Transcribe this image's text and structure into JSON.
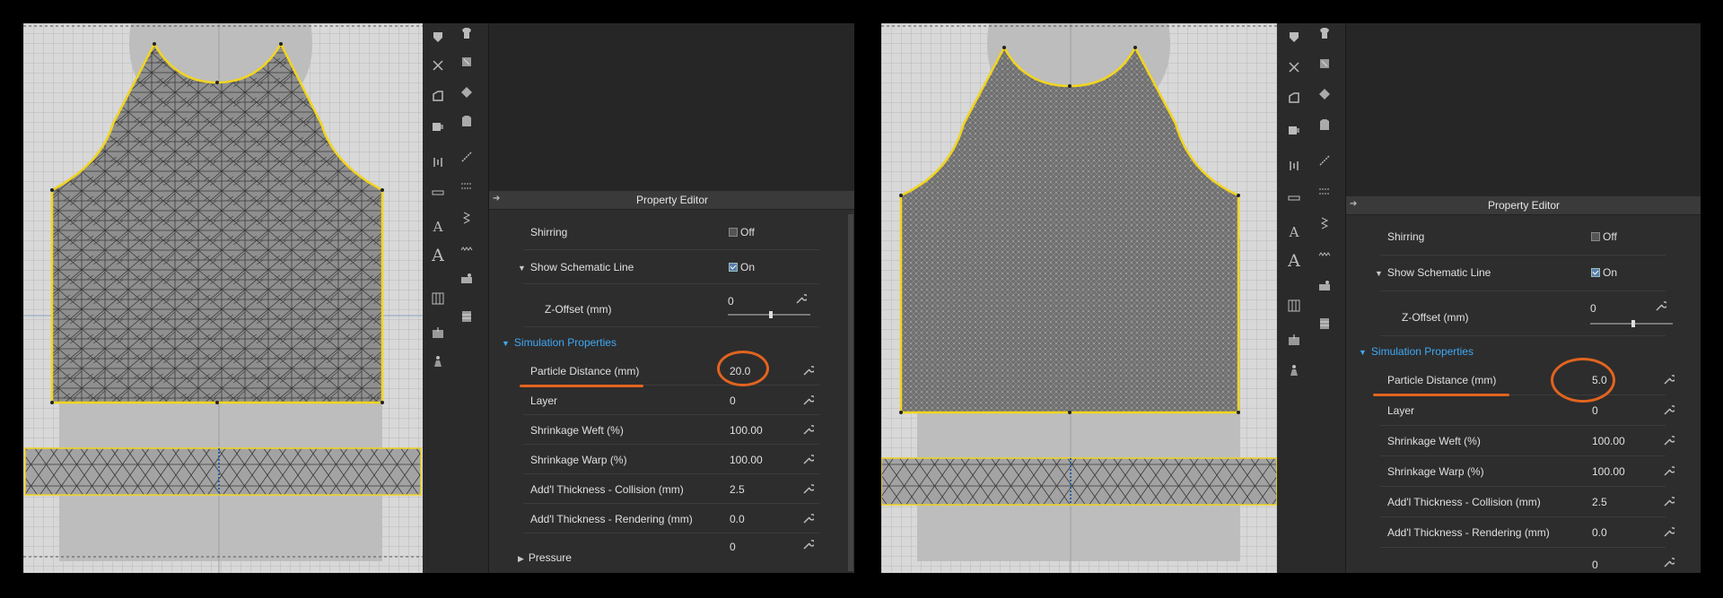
{
  "colors": {
    "orange_annotation": "#e2641f",
    "pattern_outline": "#f2d51e",
    "section_blue": "#3fa9f5",
    "panel_bg": "#2d2d2d"
  },
  "icons": {
    "left_toolbar_col1": [
      "pattern-icon",
      "cut-icon",
      "edit-curve-icon",
      "fold-icon",
      "seam-length-icon",
      "ruler-icon",
      "text-icon",
      "font-icon",
      "grid-icon",
      "fabric-icon",
      "avatar-icon"
    ],
    "left_toolbar_col2": [
      "shirt-icon",
      "shirt-pattern-icon",
      "texture-icon",
      "garment-icon",
      "line-tool-icon",
      "dashed-line-icon",
      "stitch-icon",
      "zigzag-icon",
      "sewing-machine-icon",
      "button-icon"
    ]
  },
  "left": {
    "property_editor": {
      "title": "Property Editor",
      "shirring_label": "Shirring",
      "shirring_value": "Off",
      "schematic_label": "Show Schematic Line",
      "schematic_value": "On",
      "zoffset_label": "Z-Offset (mm)",
      "zoffset_value": "0",
      "section_label": "Simulation Properties",
      "rows": [
        {
          "label": "Particle Distance (mm)",
          "value": "20.0"
        },
        {
          "label": "Layer",
          "value": "0"
        },
        {
          "label": "Shrinkage Weft (%)",
          "value": "100.00"
        },
        {
          "label": "Shrinkage Warp (%)",
          "value": "100.00"
        },
        {
          "label": "Add'l Thickness - Collision (mm)",
          "value": "2.5"
        },
        {
          "label": "Add'l Thickness - Rendering (mm)",
          "value": "0.0"
        }
      ],
      "pressure_label": "Pressure",
      "pressure_value": "0"
    }
  },
  "right": {
    "property_editor": {
      "title": "Property Editor",
      "shirring_label": "Shirring",
      "shirring_value": "Off",
      "schematic_label": "Show Schematic Line",
      "schematic_value": "On",
      "zoffset_label": "Z-Offset (mm)",
      "zoffset_value": "0",
      "section_label": "Simulation Properties",
      "rows": [
        {
          "label": "Particle Distance (mm)",
          "value": "5.0"
        },
        {
          "label": "Layer",
          "value": "0"
        },
        {
          "label": "Shrinkage Weft (%)",
          "value": "100.00"
        },
        {
          "label": "Shrinkage Warp (%)",
          "value": "100.00"
        },
        {
          "label": "Add'l Thickness - Collision (mm)",
          "value": "2.5"
        },
        {
          "label": "Add'l Thickness - Rendering (mm)",
          "value": "0.0"
        }
      ],
      "extra_value": "0"
    }
  }
}
